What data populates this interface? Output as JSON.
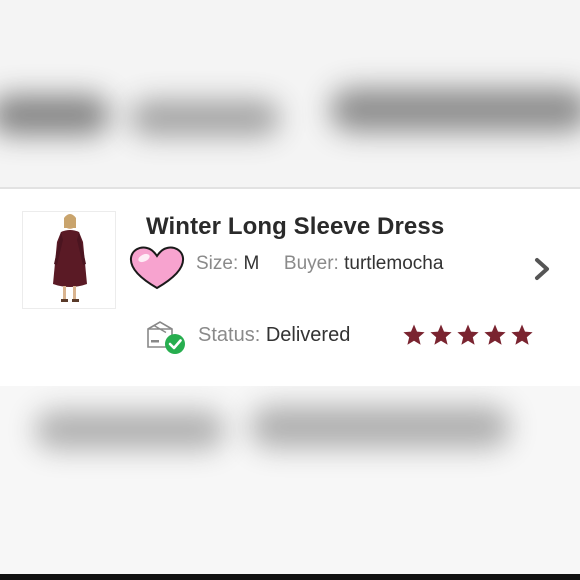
{
  "order": {
    "title": "Winter Long Sleeve Dress",
    "size_label": "Size:",
    "size_value": "M",
    "buyer_label": "Buyer:",
    "buyer_value": "turtlemocha",
    "status_label": "Status:",
    "status_value": "Delivered",
    "rating": 5,
    "rating_max": 5
  },
  "icons": {
    "product": "product-thumbnail",
    "like": "heart-icon",
    "chevron": "chevron-right-icon",
    "status": "delivered-box-icon",
    "rating": "star-icon"
  },
  "colors": {
    "star": "#7a2430",
    "heart": "#f7a3cf",
    "check": "#27ae4f",
    "dress": "#5a1a25"
  }
}
